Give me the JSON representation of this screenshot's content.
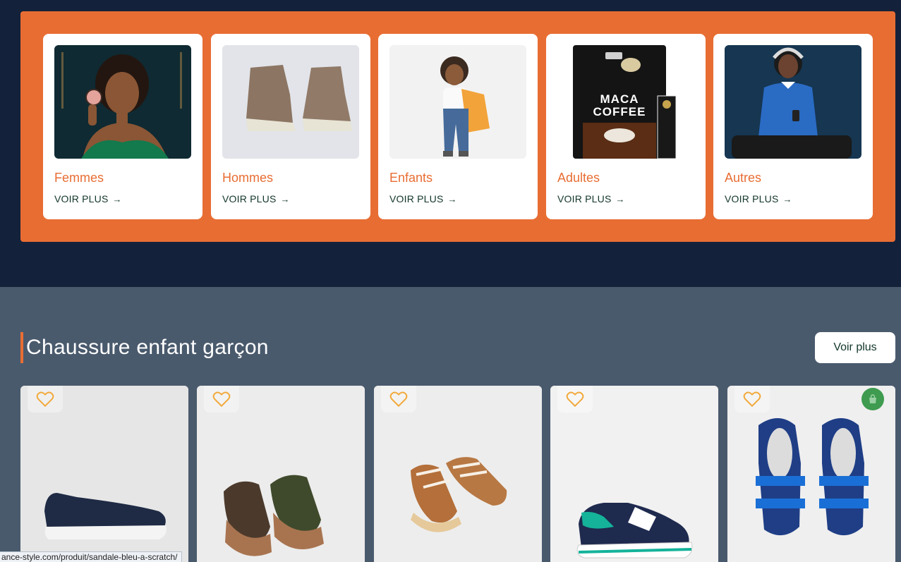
{
  "categories": [
    {
      "title": "Femmes",
      "link": "VOIR PLUS",
      "image": "woman-with-compact-photo"
    },
    {
      "title": "Hommes",
      "link": "VOIR PLUS",
      "image": "suede-boots-photo"
    },
    {
      "title": "Enfants",
      "link": "VOIR PLUS",
      "image": "child-with-backpack-photo"
    },
    {
      "title": "Adultes",
      "link": "VOIR PLUS",
      "image": "maca-coffee-pack-photo"
    },
    {
      "title": "Autres",
      "link": "VOIR PLUS",
      "image": "girl-with-headphones-photo"
    }
  ],
  "section": {
    "title": "Chaussure enfant garçon",
    "voir_plus": "Voir plus"
  },
  "products": [
    {
      "image": "navy-slip-on-shoe",
      "favorite_icon": "heart-icon"
    },
    {
      "image": "brown-sandals",
      "favorite_icon": "heart-icon"
    },
    {
      "image": "brown-sneakers",
      "favorite_icon": "heart-icon"
    },
    {
      "image": "navy-white-sneaker",
      "favorite_icon": "heart-icon"
    },
    {
      "image": "blue-scratch-sandals",
      "favorite_icon": "heart-icon",
      "cart_icon": "shopping-bag-icon"
    }
  ],
  "maca_text": [
    "MACA",
    "COFFEE"
  ],
  "status_url": "ance-style.com/produit/sandale-bleu-a-scratch/",
  "colors": {
    "accent": "#e86d33",
    "dark_bg": "#14213a",
    "section_bg": "#4a5a6d",
    "link": "#12362a",
    "heart": "#f2a93b",
    "bag": "#3e9b4f"
  }
}
